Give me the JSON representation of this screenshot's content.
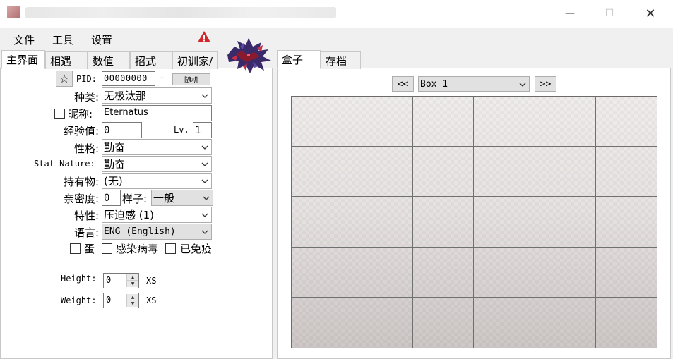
{
  "window": {
    "minimize": "—",
    "maximize": "☐",
    "close": "✕"
  },
  "menu": [
    "文件",
    "工具",
    "设置"
  ],
  "icons": {
    "warning": "warning-icon",
    "star": "star-icon",
    "sprite": "pokemon-sprite-eternatus"
  },
  "left_tabs": [
    "主界面",
    "相遇",
    "数值",
    "招式",
    "初训家/"
  ],
  "right_tabs": [
    "盒子",
    "存档"
  ],
  "form": {
    "star": "☆",
    "pid_label": "PID:",
    "pid_value": "00000000",
    "pid_dash": "-",
    "reroll_button": "随机",
    "species_label": "种类:",
    "species_value": "无极汰那",
    "nickname_label": "昵称:",
    "nickname_value": "Eternatus",
    "exp_label": "经验值:",
    "exp_value": "0",
    "level_label": "Lv.",
    "level_value": "1",
    "nature_label": "性格:",
    "nature_value": "勤奋",
    "stat_nature_label": "Stat Nature:",
    "stat_nature_value": "勤奋",
    "held_item_label": "持有物:",
    "held_item_value": "(无)",
    "friendship_label": "亲密度:",
    "friendship_value": "0",
    "form_label": "样子:",
    "form_value": "一般",
    "ability_label": "特性:",
    "ability_value": "压迫感 (1)",
    "language_label": "语言:",
    "language_value": "ENG (English)",
    "egg_label": "蛋",
    "pokerus_label": "感染病毒",
    "cured_label": "已免疫",
    "height_label": "Height:",
    "height_value": "0",
    "height_size": "XS",
    "weight_label": "Weight:",
    "weight_value": "0",
    "weight_size": "XS"
  },
  "box": {
    "prev": "<<",
    "next": ">>",
    "selected": "Box 1",
    "rows": 5,
    "columns": 6
  }
}
